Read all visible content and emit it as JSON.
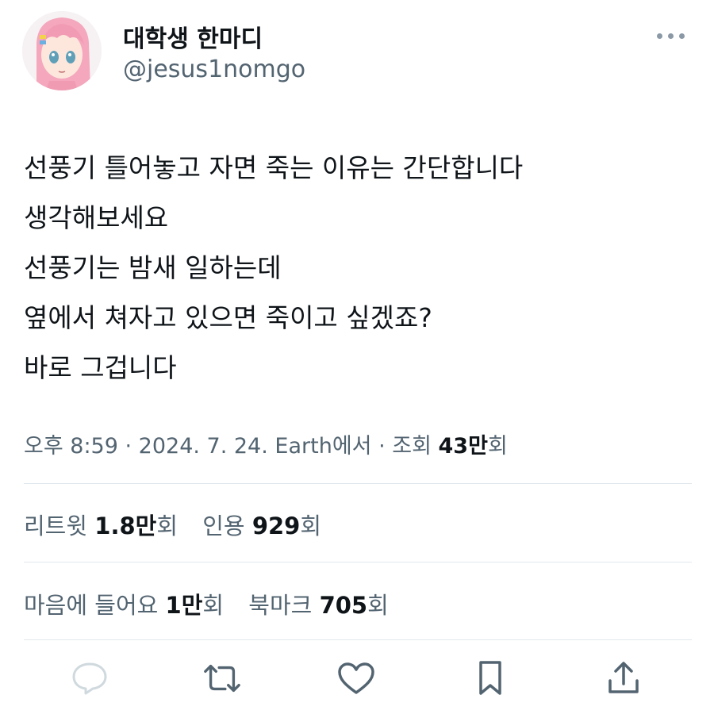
{
  "tweet": {
    "display_name": "대학생 한마디",
    "handle": "@jesus1nomgo",
    "lines": [
      "선풍기 틀어놓고 자면 죽는 이유는 간단합니다",
      "생각해보세요",
      "선풍기는 밤새 일하는데",
      "옆에서 쳐자고 있으면 죽이고 싶겠죠?",
      "바로 그겁니다"
    ],
    "meta": {
      "time": "오후 8:59",
      "sep1": " · ",
      "date": "2024. 7. 24.",
      "source": " Earth에서",
      "sep2": " · ",
      "views_label": "조회 ",
      "views_value": "43만",
      "views_suffix": "회"
    },
    "stats_row1": {
      "retweets_label": "리트윗 ",
      "retweets_value": "1.8만",
      "retweets_suffix": "회",
      "quotes_label": "인용 ",
      "quotes_value": "929",
      "quotes_suffix": "회"
    },
    "stats_row2": {
      "likes_label": "마음에 들어요 ",
      "likes_value": "1만",
      "likes_suffix": "회",
      "bookmarks_label": "북마크 ",
      "bookmarks_value": "705",
      "bookmarks_suffix": "회"
    }
  },
  "icons": {
    "more": "more-horizontal-icon",
    "reply": "reply-icon",
    "retweet": "retweet-icon",
    "like": "heart-icon",
    "bookmark": "bookmark-icon",
    "share": "share-icon"
  },
  "colors": {
    "text_primary": "#0f1419",
    "text_secondary": "#536471",
    "divider": "#e1e8ed",
    "icon": "#536471",
    "reply_icon": "#cfd9de"
  }
}
